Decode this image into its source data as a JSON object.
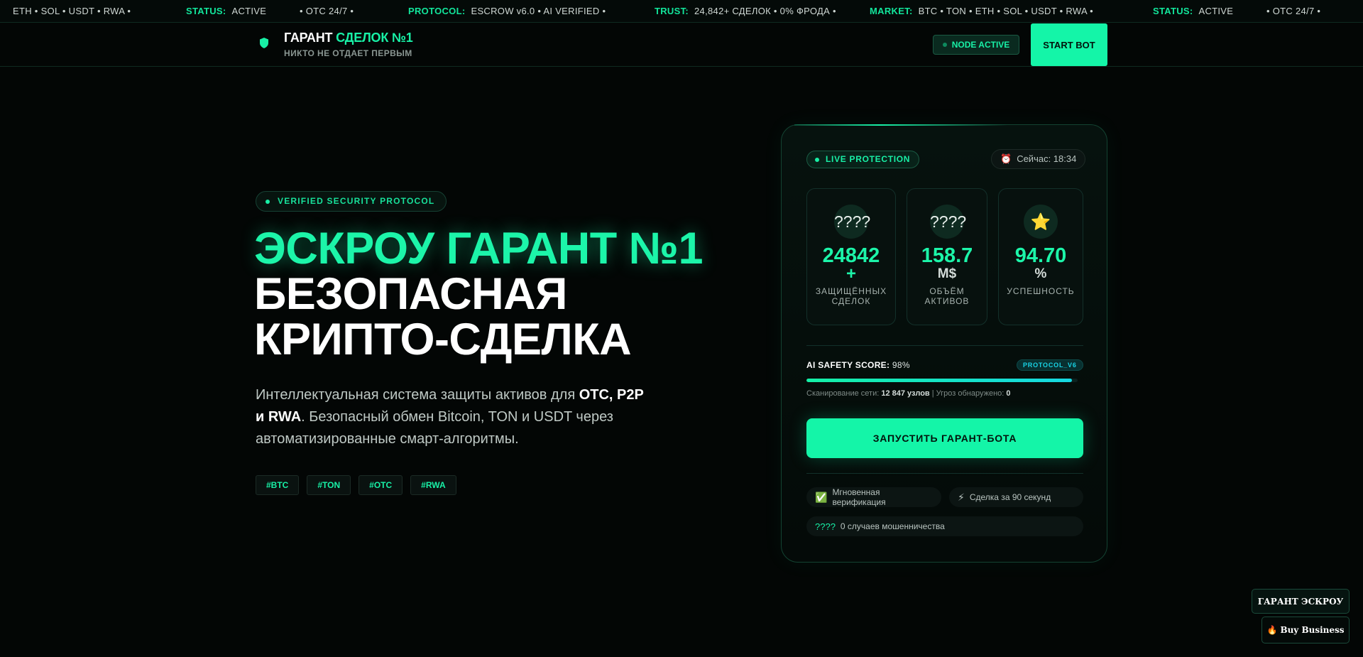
{
  "ticker": {
    "items": [
      {
        "key": "",
        "value": "ETH • SOL • USDT • RWA •"
      },
      {
        "key": "STATUS:",
        "value": "ACTIVE"
      },
      {
        "key": "",
        "value": "• OTC 24/7 •"
      },
      {
        "key": "PROTOCOL:",
        "value": "ESCROW v6.0 • AI VERIFIED •"
      },
      {
        "key": "TRUST:",
        "value": "24,842+ СДЕЛОК • 0% ФРОДА •"
      },
      {
        "key": "MARKET:",
        "value": "BTC • TON • ETH • SOL • USDT • RWA •"
      },
      {
        "key": "STATUS:",
        "value": "ACTIVE"
      },
      {
        "key": "",
        "value": "• OTC 24/7 •"
      }
    ]
  },
  "header": {
    "brand_main": "ГАРАНТ",
    "brand_accent": "СДЕЛОК №1",
    "subtitle": "НИКТО НЕ ОТДАЕТ ПЕРВЫМ",
    "node_status": "NODE ACTIVE",
    "start_bot": "START BOT"
  },
  "hero": {
    "badge": "VERIFIED SECURITY PROTOCOL",
    "title_line1": "ЭСКРОУ ГАРАНТ №1",
    "title_line2": "БЕЗОПАСНАЯ",
    "title_line3": "КРИПТО-СДЕЛКА",
    "desc_part1": "Интеллектуальная система защиты активов для ",
    "desc_bold1": "OTC, P2P и RWA",
    "desc_part2": ". Безопасный обмен Bitcoin, TON и USDT через автоматизированные смарт-алгоритмы.",
    "tags": [
      "#BTC",
      "#TON",
      "#OTC",
      "#RWA"
    ]
  },
  "card": {
    "live_label": "LIVE PROTECTION",
    "clock_icon": "⏰",
    "clock_label": "Сейчас: 18:34",
    "stats": [
      {
        "icon": "????",
        "value": "24842",
        "unit": "+",
        "label": "ЗАЩИЩЁННЫХ СДЕЛОК"
      },
      {
        "icon": "????",
        "value": "158.7",
        "unit": "M$",
        "label": "ОБЪЁМ АКТИВОВ"
      },
      {
        "icon": "⭐",
        "value": "94.70",
        "unit": "%",
        "label": "УСПЕШНОСТЬ"
      }
    ],
    "score_label": "AI SAFETY SCORE:",
    "score_value": "98%",
    "score_fraction": 0.98,
    "protocol_badge": "PROTOCOL_V6",
    "scan_label": "Сканирование сети:",
    "scan_nodes": "12 847 узлов",
    "scan_sep": "|",
    "threats_label": "Угроз обнаружено:",
    "threats_value": "0",
    "cta": "ЗАПУСТИТЬ ГАРАНТ-БОТА",
    "features": [
      {
        "icon": "✅",
        "label": "Мгновенная верификация"
      },
      {
        "icon": "⚡",
        "label": "Сделка за 90 секунд"
      },
      {
        "icon": "????",
        "label": "0 случаев мошенничества"
      }
    ]
  },
  "floating": {
    "escrow_button": "ГАРАНТ ЭСКРОУ",
    "business_icon": "🔥",
    "business_button": "Buy Business"
  },
  "colors": {
    "accent": "#14f5a8",
    "background": "#030605",
    "cyan": "#16d8e2"
  }
}
